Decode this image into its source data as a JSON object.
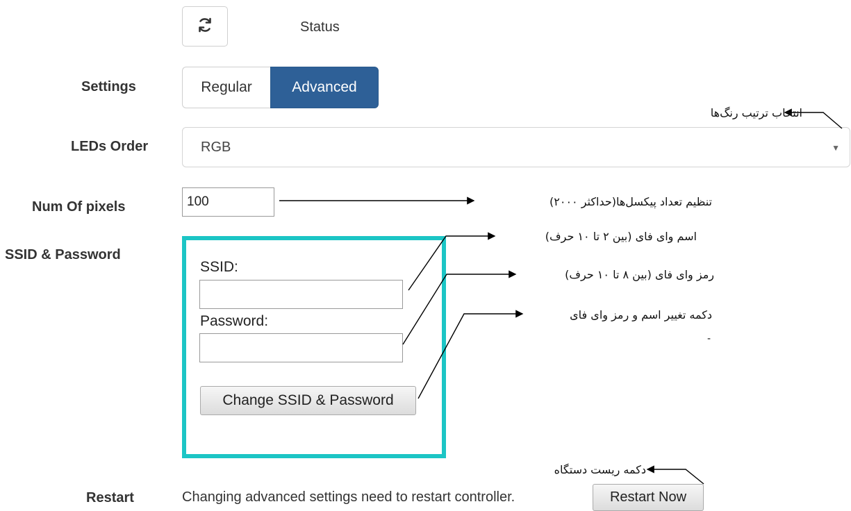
{
  "status": {
    "label": "Status",
    "refresh_icon": "refresh-icon"
  },
  "settings": {
    "label": "Settings",
    "options": [
      "Regular",
      "Advanced"
    ],
    "selected": "Advanced",
    "active_color": "#2e6097"
  },
  "leds_order": {
    "label": "LEDs Order",
    "value": "RGB"
  },
  "num_pixels": {
    "label": "Num Of pixels",
    "value": "100"
  },
  "ssid_password": {
    "label": "SSID & Password",
    "ssid_label": "SSID:",
    "ssid_value": "",
    "password_label": "Password:",
    "password_value": "",
    "change_button": "Change SSID & Password",
    "highlight_color": "#1cc5c5"
  },
  "restart": {
    "label": "Restart",
    "message": "Changing advanced settings need to restart controller.",
    "button": "Restart Now"
  },
  "annotations": {
    "leds_order_note": "انتخاب ترتیب رنگ‌ها",
    "pixels_note": "تنظیم تعداد پیکسل‌ها(حداکثر ۲۰۰۰)",
    "ssid_note": "اسم وای فای (بین ۲ تا ۱۰ حرف)",
    "password_note": "رمز وای فای (بین ۸ تا ۱۰ حرف)",
    "change_button_note": "دکمه تغییر اسم و رمز وای فای",
    "restart_note": "دکمه ریست دستگاه",
    "stray_mark": "-"
  }
}
